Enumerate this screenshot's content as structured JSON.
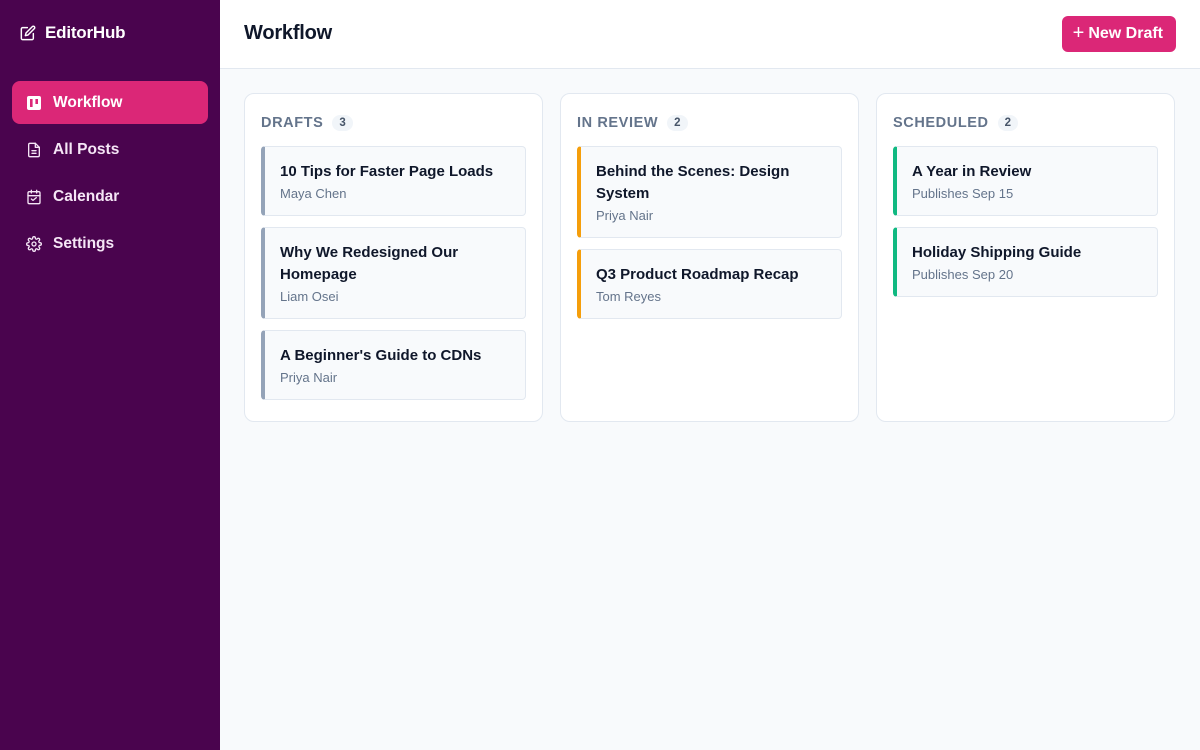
{
  "app": {
    "name": "EditorHub"
  },
  "sidebar": {
    "items": [
      {
        "label": "Workflow",
        "icon": "kanban-icon",
        "active": true
      },
      {
        "label": "All Posts",
        "icon": "document-icon",
        "active": false
      },
      {
        "label": "Calendar",
        "icon": "calendar-icon",
        "active": false
      },
      {
        "label": "Settings",
        "icon": "gear-icon",
        "active": false
      }
    ]
  },
  "header": {
    "title": "Workflow",
    "new_button_label": "New Draft",
    "new_button_icon": "+"
  },
  "columns": [
    {
      "title": "DRAFTS",
      "count": "3",
      "cards": [
        {
          "title": "10 Tips for Faster Page Loads",
          "meta": "Maya Chen"
        },
        {
          "title": "Why We Redesigned Our Homepage",
          "meta": "Liam Osei"
        },
        {
          "title": "A Beginner's Guide to CDNs",
          "meta": "Priya Nair"
        }
      ]
    },
    {
      "title": "IN REVIEW",
      "count": "2",
      "cards": [
        {
          "title": "Behind the Scenes: Design System",
          "meta": "Priya Nair"
        },
        {
          "title": "Q3 Product Roadmap Recap",
          "meta": "Tom Reyes"
        }
      ]
    },
    {
      "title": "SCHEDULED",
      "count": "2",
      "cards": [
        {
          "title": "A Year in Review",
          "meta": "Publishes Sep 15"
        },
        {
          "title": "Holiday Shipping Guide",
          "meta": "Publishes Sep 20"
        }
      ]
    }
  ],
  "colors": {
    "sidebar_bg": "#4a044e",
    "accent": "#db2777",
    "draft_border": "#94a3b8",
    "review_border": "#f59e0b",
    "scheduled_border": "#10b981"
  }
}
